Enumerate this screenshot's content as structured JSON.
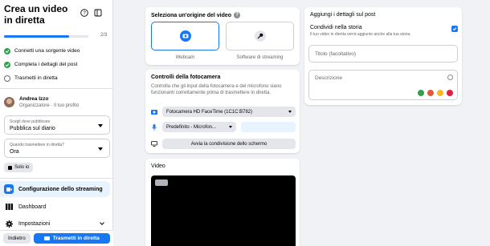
{
  "sidebar": {
    "title": "Crea un video in diretta",
    "progress": {
      "label": "2/3",
      "fraction": 0.77
    },
    "steps": [
      {
        "label": "Connetti una sorgente video",
        "status": "done"
      },
      {
        "label": "Completa i dettagli del post",
        "status": "done"
      },
      {
        "label": "Trasmetti in diretta",
        "status": "open"
      }
    ],
    "user": {
      "name": "Andrea Izzo",
      "role": "Organizzatore · Il tuo profilo"
    },
    "publish_select": {
      "label": "Scegli dove pubblicare",
      "value": "Pubblica sul diario"
    },
    "when_select": {
      "label": "Quando trasmettere in diretta?",
      "value": "Ora"
    },
    "privacy": "Solo io",
    "menu": [
      {
        "label": "Configurazione dello streaming",
        "icon": "stream-icon",
        "active": true
      },
      {
        "label": "Dashboard",
        "icon": "dashboard-icon",
        "active": false
      },
      {
        "label": "Impostazioni",
        "icon": "gear-icon",
        "active": false
      }
    ],
    "back_label": "Indietro",
    "live_label": "Trasmetti in diretta"
  },
  "source": {
    "title": "Seleziona un'origine del video",
    "options": [
      {
        "label": "Webcam",
        "icon": "camera-icon",
        "selected": true
      },
      {
        "label": "Software di streaming",
        "icon": "key-icon",
        "selected": false
      }
    ]
  },
  "camera": {
    "title": "Controlli della fotocamera",
    "description": "Controlla che gli input della fotocamera e del microfono siano funzionanti correttamente prima di trasmettere in diretta.",
    "camera_value": "Fotocamera HD FaceTime (1C1C:B782)",
    "mic_value": "Predefinito - Microfon...",
    "share_label": "Avvia la condivisione dello schermo"
  },
  "video": {
    "title": "Video"
  },
  "details": {
    "title": "Aggiungi i dettagli sul post",
    "share_story_title": "Condividi nella storia",
    "share_story_sub": "Il tuo video in diretta verrà aggiunto anche alla tua storia.",
    "share_story_checked": true,
    "title_placeholder": "Titolo (facoltativo)",
    "description_placeholder": "Descrizione"
  },
  "colors": {
    "accent": "#1877f2",
    "done": "#31a24c",
    "background": "#f0f2f5"
  }
}
